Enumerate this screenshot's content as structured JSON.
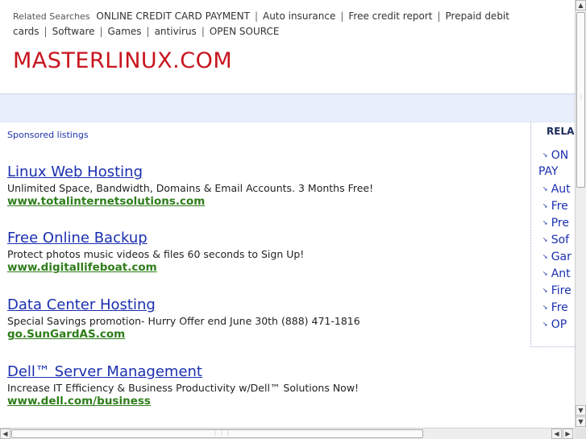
{
  "related_searches": {
    "label": "Related Searches",
    "items": [
      "ONLINE CREDIT CARD PAYMENT",
      "Auto insurance",
      "Free credit report",
      "Prepaid debit cards",
      "Software",
      "Games",
      "antivirus",
      "OPEN SOURCE"
    ],
    "separator": "|"
  },
  "site": {
    "title": "MASTERLINUX.COM"
  },
  "sponsored_label": "Sponsored listings",
  "listings": [
    {
      "title": "Linux Web Hosting",
      "desc": "Unlimited Space, Bandwidth, Domains & Email Accounts. 3 Months Free!",
      "url": "www.totalinternetsolutions.com"
    },
    {
      "title": "Free Online Backup",
      "desc": "Protect photos music videos & files 60 seconds to Sign Up!",
      "url": "www.digitallifeboat.com"
    },
    {
      "title": "Data Center Hosting",
      "desc": "Special Savings promotion- Hurry Offer end June 30th (888) 471-1816",
      "url": "go.SunGardAS.com"
    },
    {
      "title": "Dell™ Server Management",
      "desc": "Increase IT Efficiency & Business Productivity w/Dell™ Solutions Now!",
      "url": "www.dell.com/business"
    }
  ],
  "sidebar": {
    "heading": "RELA",
    "items": [
      "ON",
      "Aut",
      "Fre",
      "Pre",
      "Sof",
      "Gar",
      "Ant",
      "Fire",
      "Fre",
      "OP"
    ],
    "first_item_continuation": "PAY"
  },
  "scrollbar": {
    "up": "▲",
    "down": "▼",
    "left": "◀",
    "right": "▶"
  }
}
